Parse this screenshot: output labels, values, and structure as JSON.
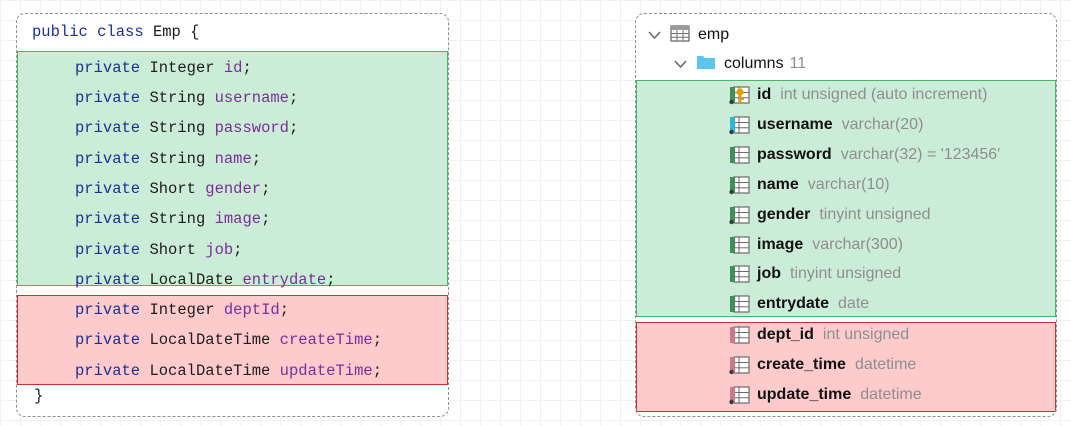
{
  "class_panel": {
    "header": {
      "kw1": "public",
      "kw2": "class",
      "name": "Emp",
      "brace": "{"
    },
    "fields": [
      {
        "modifier": "private",
        "type": "Integer",
        "name": "id",
        "group": "matched"
      },
      {
        "modifier": "private",
        "type": "String",
        "name": "username",
        "group": "matched"
      },
      {
        "modifier": "private",
        "type": "String",
        "name": "password",
        "group": "matched"
      },
      {
        "modifier": "private",
        "type": "String",
        "name": "name",
        "group": "matched"
      },
      {
        "modifier": "private",
        "type": "Short",
        "name": "gender",
        "group": "matched"
      },
      {
        "modifier": "private",
        "type": "String",
        "name": "image",
        "group": "matched"
      },
      {
        "modifier": "private",
        "type": "Short",
        "name": "job",
        "group": "matched"
      },
      {
        "modifier": "private",
        "type": "LocalDate",
        "name": "entrydate",
        "group": "matched"
      },
      {
        "modifier": "private",
        "type": "Integer",
        "name": "deptId",
        "group": "mismatched"
      },
      {
        "modifier": "private",
        "type": "LocalDateTime",
        "name": "createTime",
        "group": "mismatched"
      },
      {
        "modifier": "private",
        "type": "LocalDateTime",
        "name": "updateTime",
        "group": "mismatched"
      }
    ],
    "semicolon": ";",
    "closing": "}"
  },
  "db_panel": {
    "table": {
      "name": "emp",
      "icon": "table-icon",
      "expand_icon": "chevron-down-icon"
    },
    "columns_folder": {
      "label": "columns",
      "count": "11",
      "icon": "folder-icon",
      "expand_icon": "chevron-down-icon"
    },
    "columns": [
      {
        "name": "id",
        "type": "int unsigned (auto increment)",
        "icon": "primary-key-column-icon",
        "group": "matched"
      },
      {
        "name": "username",
        "type": "varchar(20)",
        "icon": "unique-column-icon",
        "group": "matched"
      },
      {
        "name": "password",
        "type": "varchar(32) = '123456'",
        "icon": "column-icon",
        "group": "matched"
      },
      {
        "name": "name",
        "type": "varchar(10)",
        "icon": "not-null-column-icon",
        "group": "matched"
      },
      {
        "name": "gender",
        "type": "tinyint unsigned",
        "icon": "not-null-column-icon",
        "group": "matched"
      },
      {
        "name": "image",
        "type": "varchar(300)",
        "icon": "column-icon",
        "group": "matched"
      },
      {
        "name": "job",
        "type": "tinyint unsigned",
        "icon": "column-icon",
        "group": "matched"
      },
      {
        "name": "entrydate",
        "type": "date",
        "icon": "column-icon",
        "group": "matched"
      },
      {
        "name": "dept_id",
        "type": "int unsigned",
        "icon": "column-icon",
        "group": "mismatched"
      },
      {
        "name": "create_time",
        "type": "datetime",
        "icon": "not-null-column-icon",
        "group": "mismatched"
      },
      {
        "name": "update_time",
        "type": "datetime",
        "icon": "not-null-column-icon",
        "group": "mismatched"
      }
    ]
  },
  "colors": {
    "match_fill": "#cbedd7",
    "match_border": "#46b566",
    "mismatch_fill": "#fdcbcb",
    "mismatch_border": "#c93131",
    "keyword": "#1b2f96",
    "field_name": "#7a2d9a",
    "green_icon": "#3f8f58",
    "pink_icon": "#c97a86",
    "gold_key": "#e0a100",
    "cyan_icon": "#2bb7d6"
  }
}
